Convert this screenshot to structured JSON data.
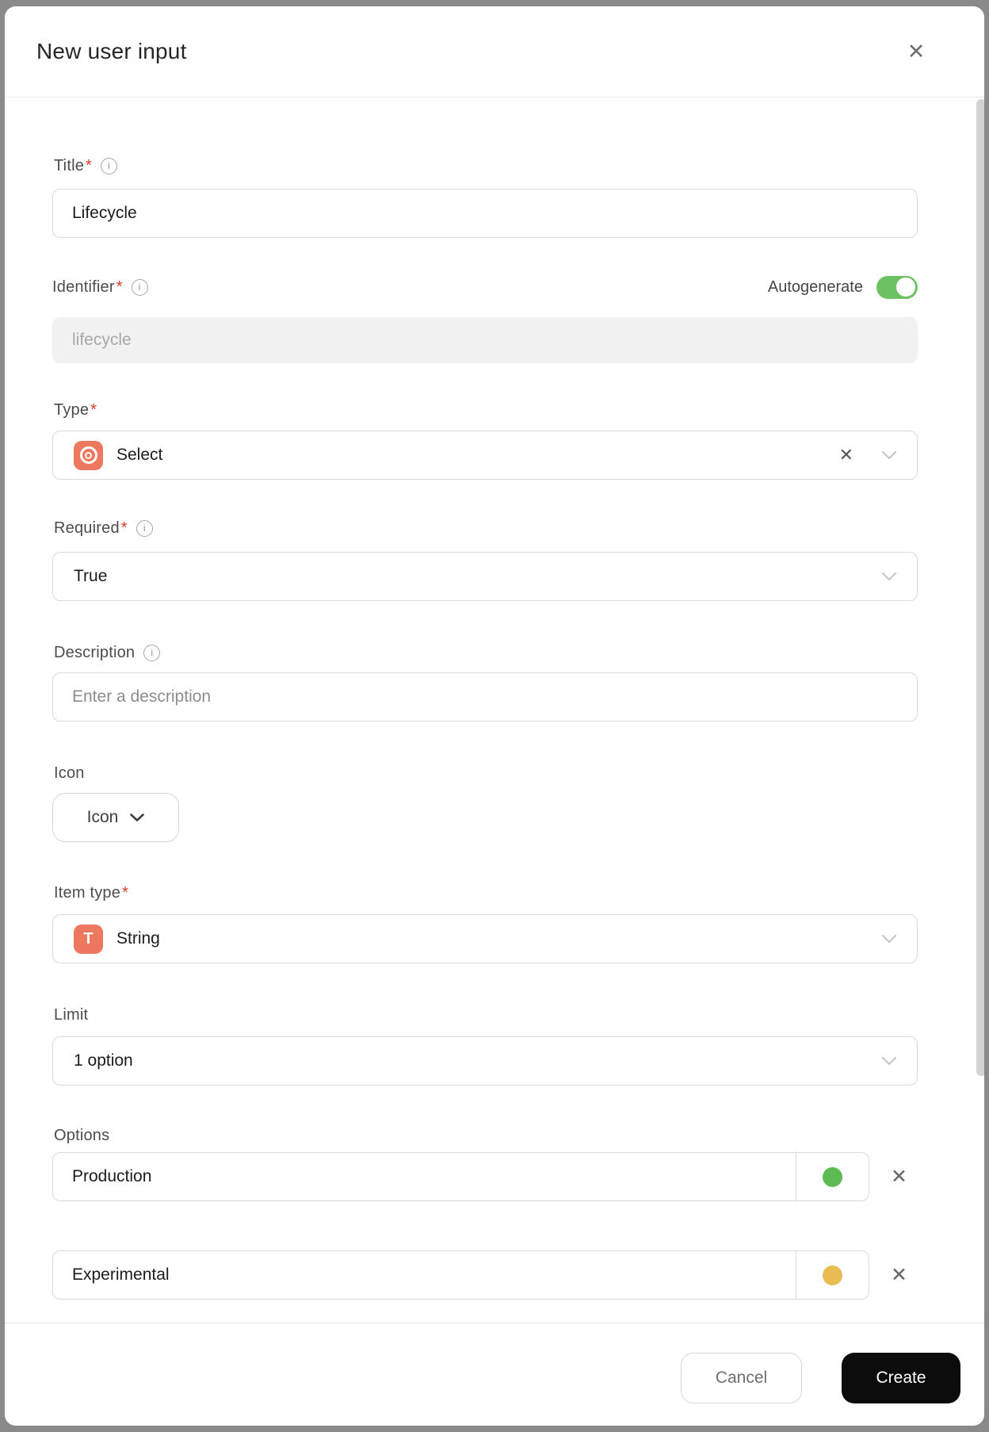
{
  "dialog": {
    "title": "New user input"
  },
  "icons": {
    "close": "✕",
    "clear": "✕",
    "remove": "✕",
    "info": "i",
    "item_type_glyph": "T"
  },
  "colors": {
    "toggle_on": "#6cc262",
    "type_accent": "#ee785f",
    "create_bg": "#0c0c0c"
  },
  "fields": {
    "title": {
      "label": "Title",
      "required": "*",
      "value": "Lifecycle"
    },
    "identifier": {
      "label": "Identifier",
      "required": "*",
      "toggle_label": "Autogenerate",
      "toggle_state": "on",
      "value": "lifecycle"
    },
    "type": {
      "label": "Type",
      "required": "*",
      "value": "Select"
    },
    "required": {
      "label": "Required",
      "required": "*",
      "value": "True"
    },
    "description": {
      "label": "Description",
      "placeholder": "Enter a description"
    },
    "icon": {
      "label": "Icon",
      "button_label": "Icon"
    },
    "item_type": {
      "label": "Item type",
      "required": "*",
      "value": "String"
    },
    "limit": {
      "label": "Limit",
      "value": "1 option"
    },
    "options": {
      "label": "Options",
      "items": [
        {
          "value": "Production",
          "color": "#5cbb52"
        },
        {
          "value": "Experimental",
          "color": "#e8bc50"
        }
      ]
    }
  },
  "footer": {
    "cancel_label": "Cancel",
    "create_label": "Create"
  }
}
